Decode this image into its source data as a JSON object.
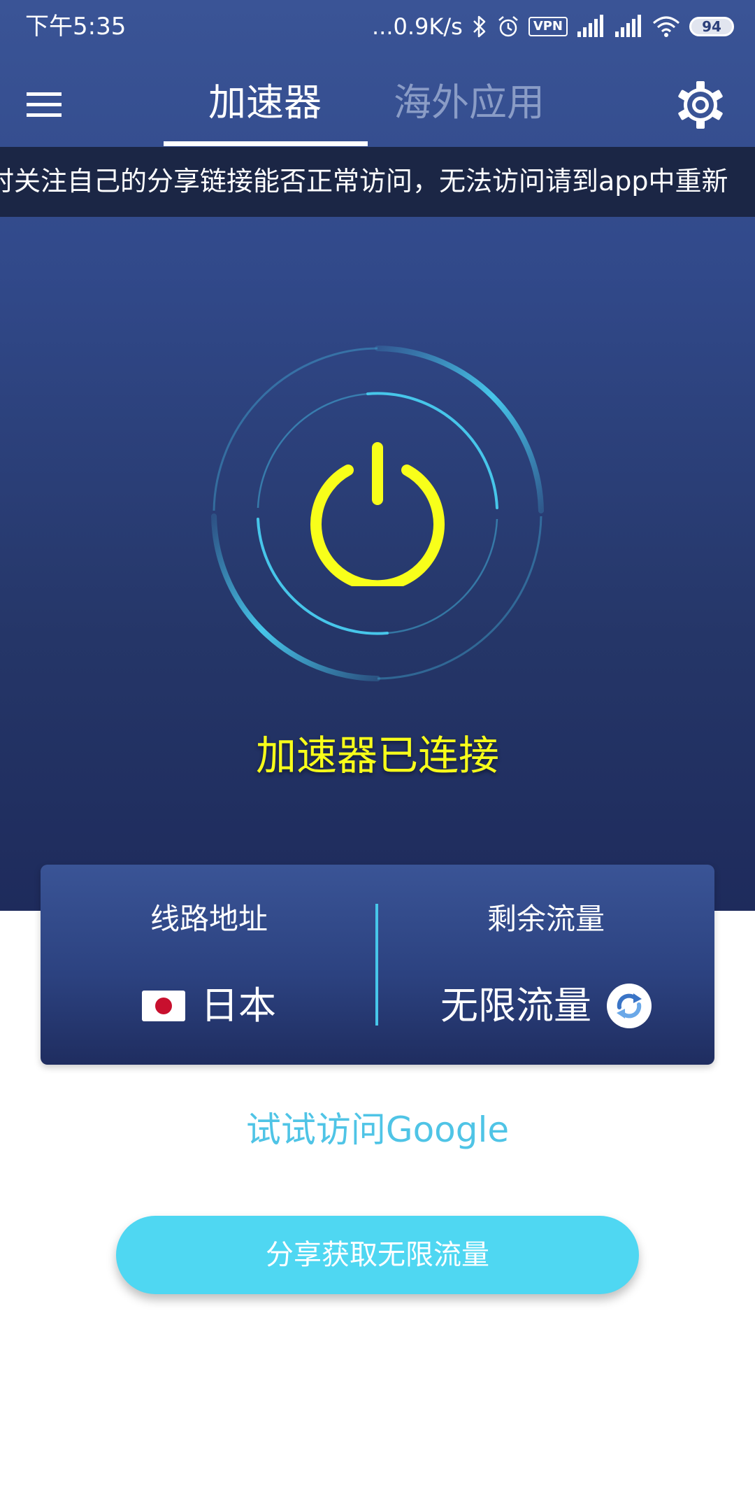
{
  "status_bar": {
    "time": "下午5:35",
    "network_speed": "...0.9K/s",
    "vpn_label": "VPN",
    "battery_level": "94"
  },
  "nav": {
    "tabs": [
      {
        "label": "加速器",
        "active": true
      },
      {
        "label": "海外应用",
        "active": false
      }
    ]
  },
  "notice": {
    "text": "时关注自己的分享链接能否正常访问，无法访问请到app中重新"
  },
  "connection": {
    "status_text": "加速器已连接"
  },
  "info_card": {
    "route_label": "线路地址",
    "route_value": "日本",
    "traffic_label": "剩余流量",
    "traffic_value": "无限流量"
  },
  "google_link": "试试访问Google",
  "share_button": "分享获取无限流量",
  "colors": {
    "hero_top": "#3a5496",
    "hero_bottom": "#1e2b5c",
    "accent_cyan": "#4fd7f2",
    "link_cyan": "#4fc4e6",
    "power_yellow": "#f8ff1a",
    "ring_blue": "#47c6ea"
  },
  "icons": {
    "menu": "hamburger-menu-icon",
    "settings": "gear-icon",
    "power": "power-icon",
    "flag": "japan-flag-icon",
    "refresh": "refresh-icon"
  }
}
